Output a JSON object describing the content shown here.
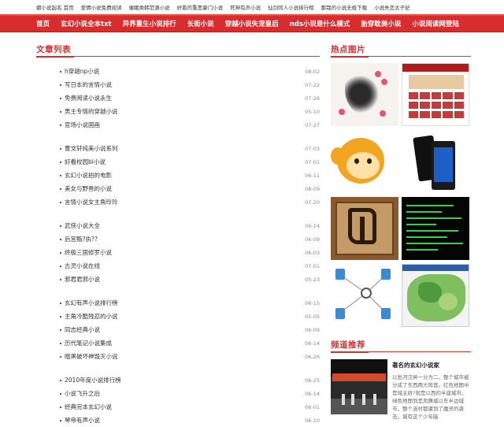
{
  "topbar": {
    "links": [
      "蟒小说起名 首页",
      "爱情小说免费阅读",
      "催眠类韩范源小说",
      "好看的重黑豪门小说",
      "死神有声小说",
      "仙剑同人小说排行榜",
      "鄙哉的小说无极下载",
      "小说失恋太子妃"
    ]
  },
  "nav": {
    "items": [
      "首页",
      "玄幻小说全本txt",
      "异界重生小说排行",
      "长街小说",
      "穿越小说失宠皇后",
      "nds小说是什么模式",
      "胎穿耽美小说",
      "小说阅读网登陆"
    ]
  },
  "articles": {
    "title": "文章列表",
    "groups": [
      [
        {
          "title": "h穿越np小说",
          "date": "08-02"
        },
        {
          "title": "写日本的言情小说",
          "date": "07-22"
        },
        {
          "title": "免费阅读小说永生",
          "date": "07-26"
        },
        {
          "title": "男主专情的穿越小说",
          "date": "05-10"
        },
        {
          "title": "官场小说国画",
          "date": "07-27"
        }
      ],
      [
        {
          "title": "曹文轩纯美小说系列",
          "date": "07-03"
        },
        {
          "title": "好看校园bl小说",
          "date": "07-01"
        },
        {
          "title": "玄幻小说拍的电影",
          "date": "06-11"
        },
        {
          "title": "美女与野兽的小说",
          "date": "08-09"
        },
        {
          "title": "言情小说女主角玲玲",
          "date": "07-20"
        }
      ],
      [
        {
          "title": "武侠小说大全",
          "date": "06-14"
        },
        {
          "title": "后宫甄?执??",
          "date": "06-09"
        },
        {
          "title": "终极三国修罗小说",
          "date": "06-03"
        },
        {
          "title": "古灵小说在线",
          "date": "07-01"
        },
        {
          "title": "邪君君邪小说",
          "date": "05-23"
        }
      ],
      [
        {
          "title": "玄幻有声小说排行榜",
          "date": "06-15"
        },
        {
          "title": "主角冷酷残忍的小说",
          "date": "05-05"
        },
        {
          "title": "同志经典小说",
          "date": "06-09"
        },
        {
          "title": "历代笔记小说集成",
          "date": "06-14"
        },
        {
          "title": "暗黑破坏神毁灭小说",
          "date": "06-26"
        }
      ],
      [
        {
          "title": "2010年度小说排行榜",
          "date": "06-25"
        },
        {
          "title": "小说飞升之后",
          "date": "06-14"
        },
        {
          "title": "经典完本玄幻小说",
          "date": "06-01"
        },
        {
          "title": "琴帝有声小说",
          "date": "06-10"
        }
      ]
    ]
  },
  "hot_pics": {
    "title": "热点图片"
  },
  "recommend": {
    "title": "频道推荐",
    "item_title": "著名的玄幻小说家",
    "item_desc": "以愁河汉昇一分为二，整个城市被分成了东西两大阵营。红色地图中是城主府?就是以西的半座城市。绿色地图到是凤舞城以东半边城市，整个涟村都遭到了魔灵的袭击。城有这个少年脑"
  },
  "colors": {
    "accent": "#d82d2d",
    "nav_bg": "#d82d2d"
  }
}
